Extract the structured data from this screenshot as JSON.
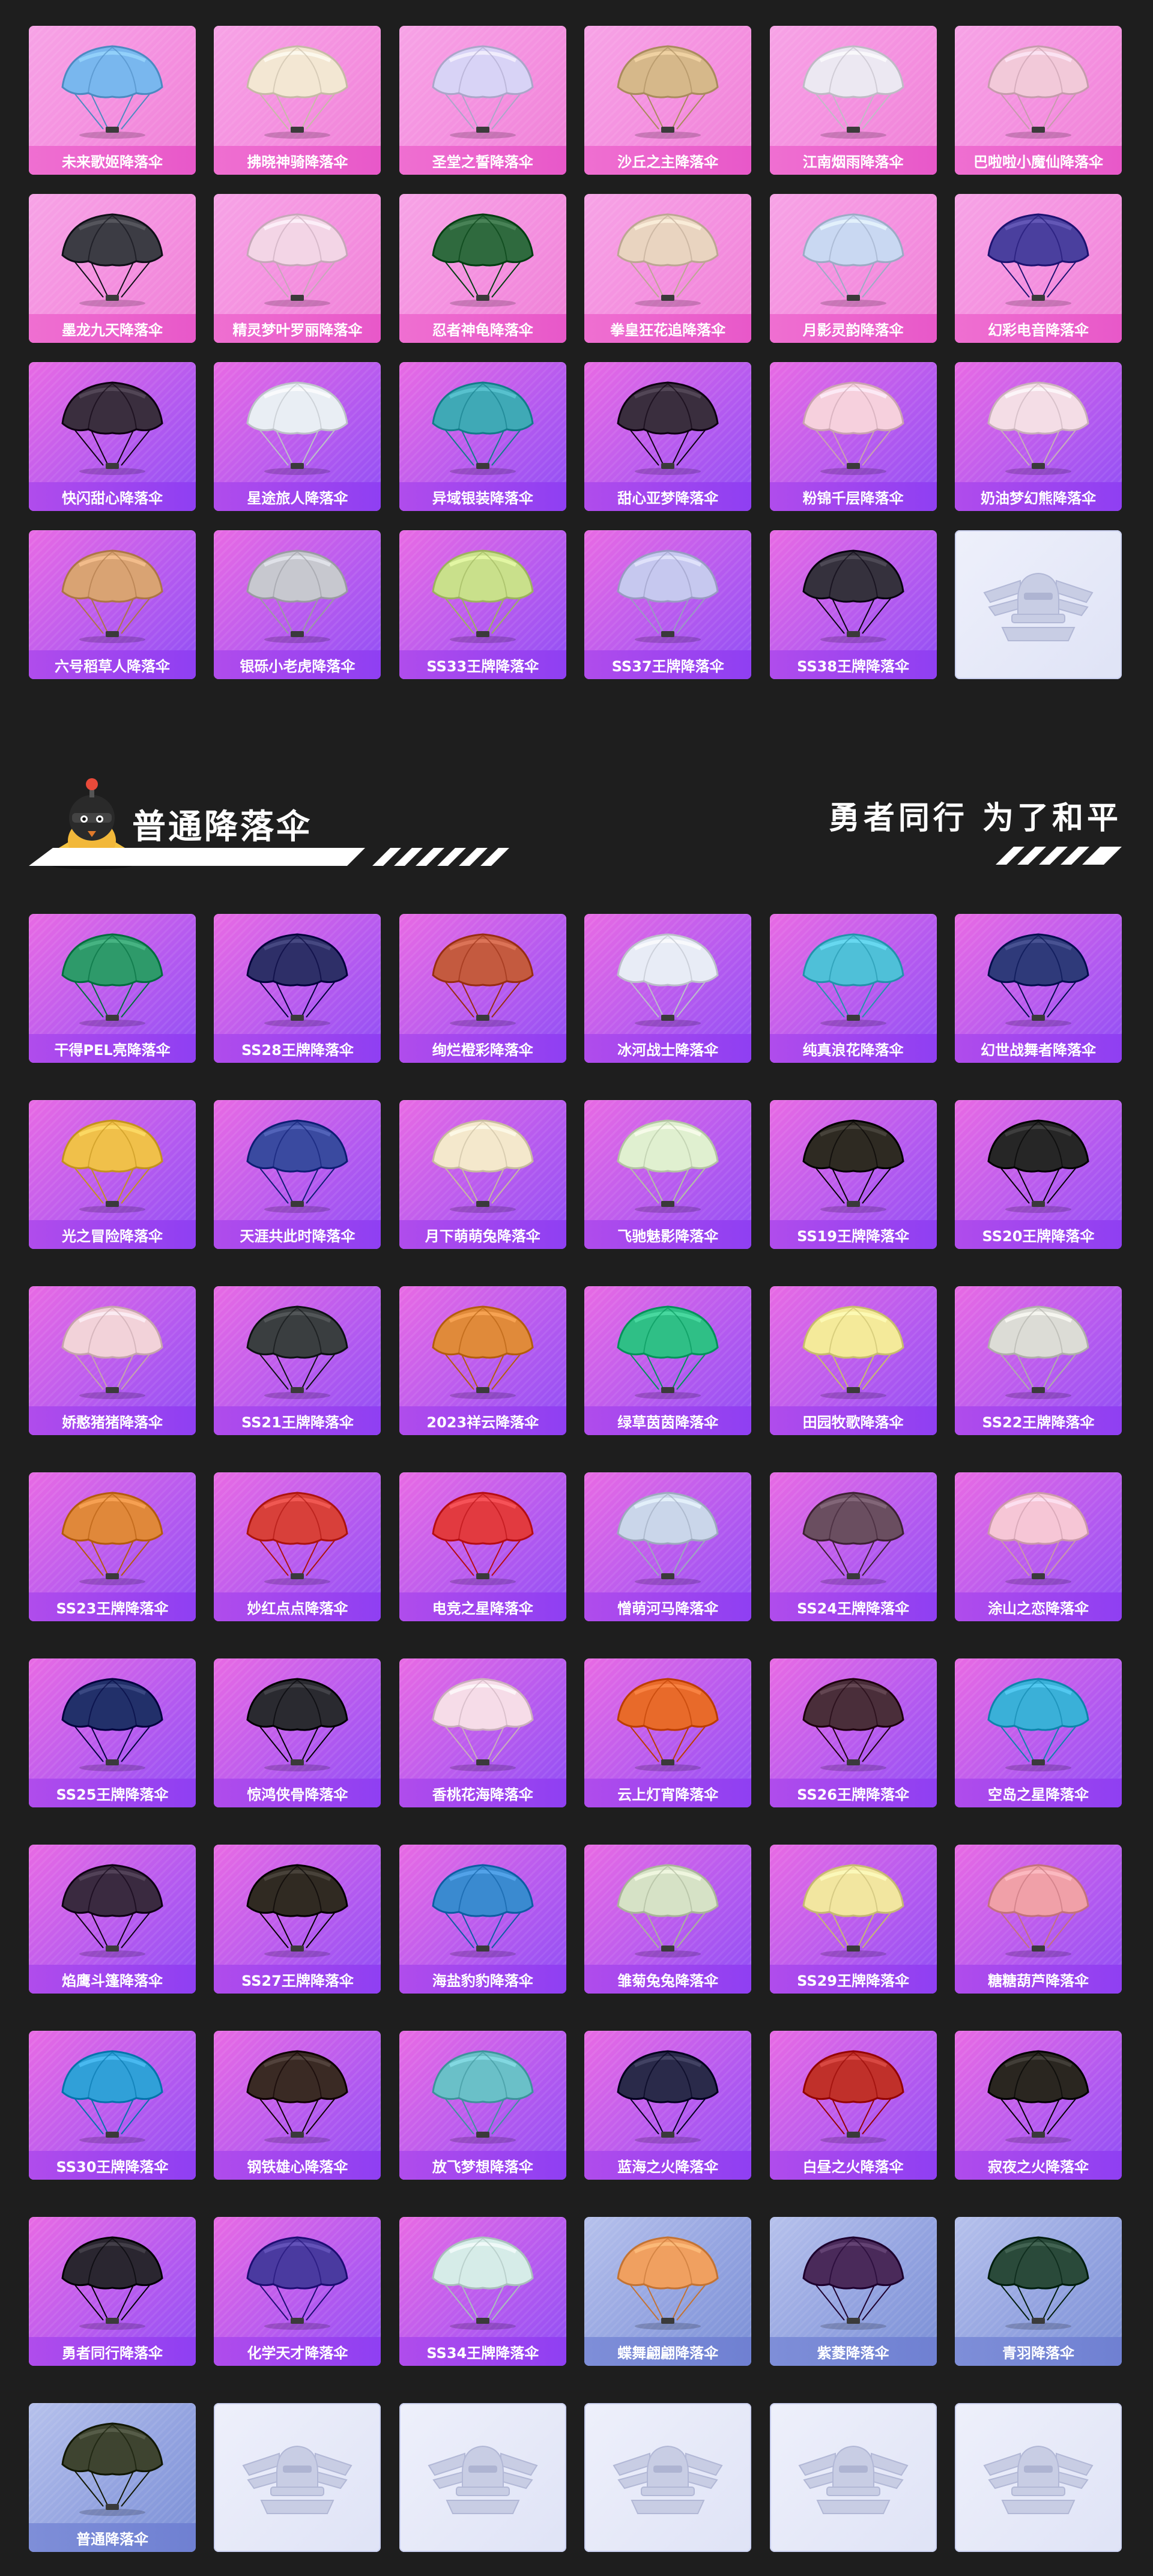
{
  "top_items": [
    {
      "label": "未来歌姬降落伞",
      "color": "#79b7ee",
      "style": "pink"
    },
    {
      "label": "拂晓神骑降落伞",
      "color": "#f3e7d3",
      "style": "pink"
    },
    {
      "label": "圣堂之誓降落伞",
      "color": "#d8d3f6",
      "style": "pink"
    },
    {
      "label": "沙丘之主降落伞",
      "color": "#d6b88a",
      "style": "pink"
    },
    {
      "label": "江南烟雨降落伞",
      "color": "#ece8f2",
      "style": "pink"
    },
    {
      "label": "巴啦啦小魔仙降落伞",
      "color": "#f2c9d9",
      "style": "pink"
    },
    {
      "label": "墨龙九天降落伞",
      "color": "#3c3c44",
      "style": "pink"
    },
    {
      "label": "精灵梦叶罗丽降落伞",
      "color": "#f3d5e6",
      "style": "pink"
    },
    {
      "label": "忍者神龟降落伞",
      "color": "#2f6a3e",
      "style": "pink"
    },
    {
      "label": "拳皇狂花追降落伞",
      "color": "#e9d4c0",
      "style": "pink"
    },
    {
      "label": "月影灵韵降落伞",
      "color": "#c9d8f2",
      "style": "pink"
    },
    {
      "label": "幻彩电音降落伞",
      "color": "#4a3f9e",
      "style": "pink"
    },
    {
      "label": "快闪甜心降落伞",
      "color": "#3a2e3e",
      "style": "purple"
    },
    {
      "label": "星途旅人降落伞",
      "color": "#e9eef4",
      "style": "purple"
    },
    {
      "label": "异域银装降落伞",
      "color": "#3fa9b6",
      "style": "purple"
    },
    {
      "label": "甜心亚梦降落伞",
      "color": "#3a2e3e",
      "style": "purple"
    },
    {
      "label": "粉锦千层降落伞",
      "color": "#f6d0dd",
      "style": "purple"
    },
    {
      "label": "奶油梦幻熊降落伞",
      "color": "#f4dde6",
      "style": "purple"
    },
    {
      "label": "六号稻草人降落伞",
      "color": "#d9a373",
      "style": "purple"
    },
    {
      "label": "银砾小老虎降落伞",
      "color": "#c7c8cf",
      "style": "purple"
    },
    {
      "label": "SS33王牌降落伞",
      "color": "#c9e08b",
      "style": "purple"
    },
    {
      "label": "SS37王牌降落伞",
      "color": "#c6c8ef",
      "style": "purple"
    },
    {
      "label": "SS38王牌降落伞",
      "color": "#35313d",
      "style": "purple"
    }
  ],
  "section": {
    "title": "普通降落伞",
    "slogan": "勇者同行 为了和平"
  },
  "bottom_items": [
    {
      "label": "干得PEL亮降落伞",
      "color": "#2e9a6a",
      "style": "purple"
    },
    {
      "label": "SS28王牌降落伞",
      "color": "#2e2f68",
      "style": "purple"
    },
    {
      "label": "绚烂橙彩降落伞",
      "color": "#c45a3f",
      "style": "purple"
    },
    {
      "label": "冰河战士降落伞",
      "color": "#e8ecf6",
      "style": "purple"
    },
    {
      "label": "纯真浪花降落伞",
      "color": "#4fc0d8",
      "style": "purple"
    },
    {
      "label": "幻世战舞者降落伞",
      "color": "#2f3a7a",
      "style": "purple"
    },
    {
      "label": "光之冒险降落伞",
      "color": "#f0c04a",
      "style": "purple"
    },
    {
      "label": "天涯共此时降落伞",
      "color": "#3a4aa0",
      "style": "purple"
    },
    {
      "label": "月下萌萌兔降落伞",
      "color": "#f4e8cc",
      "style": "purple"
    },
    {
      "label": "飞驰魅影降落伞",
      "color": "#e0f0d0",
      "style": "purple"
    },
    {
      "label": "SS19王牌降落伞",
      "color": "#2e2a22",
      "style": "purple"
    },
    {
      "label": "SS20王牌降落伞",
      "color": "#262626",
      "style": "purple"
    },
    {
      "label": "娇憨猪猪降落伞",
      "color": "#f2d2d9",
      "style": "purple"
    },
    {
      "label": "SS21王牌降落伞",
      "color": "#3a3e40",
      "style": "purple"
    },
    {
      "label": "2023祥云降落伞",
      "color": "#e08a3a",
      "style": "purple"
    },
    {
      "label": "绿草茵茵降落伞",
      "color": "#2fbf86",
      "style": "purple"
    },
    {
      "label": "田园牧歌降落伞",
      "color": "#f4ea9a",
      "style": "purple"
    },
    {
      "label": "SS22王牌降落伞",
      "color": "#dcdcd6",
      "style": "purple"
    },
    {
      "label": "SS23王牌降落伞",
      "color": "#e0883a",
      "style": "purple"
    },
    {
      "label": "妙红点点降落伞",
      "color": "#d8403a",
      "style": "purple"
    },
    {
      "label": "电竞之星降落伞",
      "color": "#e23a40",
      "style": "purple"
    },
    {
      "label": "憎萌河马降落伞",
      "color": "#cad6ea",
      "style": "purple"
    },
    {
      "label": "SS24王牌降落伞",
      "color": "#6a4e60",
      "style": "purple"
    },
    {
      "label": "涂山之恋降落伞",
      "color": "#f6c6d6",
      "style": "purple"
    },
    {
      "label": "SS25王牌降落伞",
      "color": "#22306a",
      "style": "purple"
    },
    {
      "label": "惊鸿侠骨降落伞",
      "color": "#2a2a30",
      "style": "purple"
    },
    {
      "label": "香桃花海降落伞",
      "color": "#f6dce8",
      "style": "purple"
    },
    {
      "label": "云上灯宵降落伞",
      "color": "#e86a2a",
      "style": "purple"
    },
    {
      "label": "SS26王牌降落伞",
      "color": "#4a2e3a",
      "style": "purple"
    },
    {
      "label": "空岛之星降落伞",
      "color": "#3ab0d8",
      "style": "purple"
    },
    {
      "label": "焰鹰斗篷降落伞",
      "color": "#3a2a40",
      "style": "purple"
    },
    {
      "label": "SS27王牌降落伞",
      "color": "#302a22",
      "style": "purple"
    },
    {
      "label": "海盐豹豹降落伞",
      "color": "#3a8ad0",
      "style": "purple"
    },
    {
      "label": "雏菊兔兔降落伞",
      "color": "#d6e2c6",
      "style": "purple"
    },
    {
      "label": "SS29王牌降落伞",
      "color": "#f2e6a0",
      "style": "purple"
    },
    {
      "label": "糖糖葫芦降落伞",
      "color": "#f0a0a8",
      "style": "purple"
    },
    {
      "label": "SS30王牌降落伞",
      "color": "#30a0d8",
      "style": "purple"
    },
    {
      "label": "钢铁雄心降落伞",
      "color": "#3a2a24",
      "style": "purple"
    },
    {
      "label": "放飞梦想降落伞",
      "color": "#6ac0c8",
      "style": "purple"
    },
    {
      "label": "蓝海之火降落伞",
      "color": "#2a2a4a",
      "style": "purple"
    },
    {
      "label": "白昼之火降落伞",
      "color": "#c0302a",
      "style": "purple"
    },
    {
      "label": "寂夜之火降落伞",
      "color": "#2a2620",
      "style": "purple"
    },
    {
      "label": "勇者同行降落伞",
      "color": "#2a2630",
      "style": "purple"
    },
    {
      "label": "化学天才降落伞",
      "color": "#4a3aa0",
      "style": "purple"
    },
    {
      "label": "SS34王牌降落伞",
      "color": "#d6ece8",
      "style": "purple"
    },
    {
      "label": "蝶舞翩翩降落伞",
      "color": "#f0a060",
      "style": "blue"
    },
    {
      "label": "紫菱降落伞",
      "color": "#4a2a5a",
      "style": "blue"
    },
    {
      "label": "青羽降落伞",
      "color": "#2a4a3a",
      "style": "blue"
    },
    {
      "label": "普通降落伞",
      "color": "#3e4430",
      "style": "blue"
    }
  ],
  "top_empty_count": 1,
  "bottom_empty_count": 5
}
